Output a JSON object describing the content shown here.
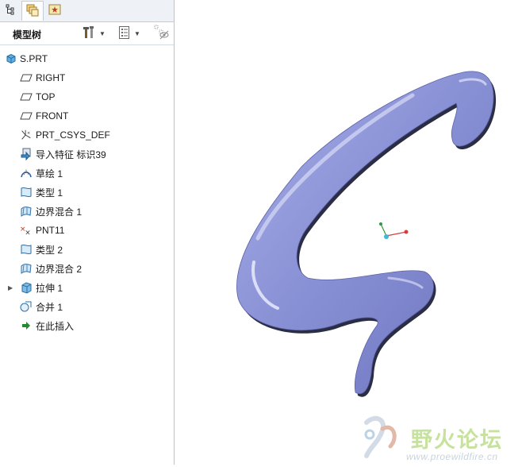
{
  "tabs": [
    {
      "name": "model-tree-tab",
      "icon": "tree-structure-icon"
    },
    {
      "name": "folder-browser-tab",
      "icon": "folders-icon"
    },
    {
      "name": "favorites-tab",
      "icon": "star-icon"
    }
  ],
  "header": {
    "title": "模型树",
    "settings_icon": "tools-icon",
    "show_icon": "list-icon",
    "filter_icon": "filter-icon"
  },
  "tree": {
    "root": "S.PRT",
    "items": [
      {
        "label": "RIGHT",
        "icon": "datum-plane-icon"
      },
      {
        "label": "TOP",
        "icon": "datum-plane-icon"
      },
      {
        "label": "FRONT",
        "icon": "datum-plane-icon"
      },
      {
        "label": "PRT_CSYS_DEF",
        "icon": "csys-icon"
      },
      {
        "label": "导入特征 标识39",
        "icon": "import-feature-icon"
      },
      {
        "label": "草绘 1",
        "icon": "sketch-icon"
      },
      {
        "label": "类型 1",
        "icon": "style-surface-icon"
      },
      {
        "label": "边界混合 1",
        "icon": "boundary-blend-icon"
      },
      {
        "label": "PNT11",
        "icon": "datum-point-icon"
      },
      {
        "label": "类型 2",
        "icon": "style-surface-icon"
      },
      {
        "label": "边界混合 2",
        "icon": "boundary-blend-icon"
      },
      {
        "label": "拉伸 1",
        "icon": "extrude-icon",
        "expandable": true
      },
      {
        "label": "合并 1",
        "icon": "merge-icon"
      },
      {
        "label": "在此插入",
        "icon": "insert-here-icon"
      }
    ]
  },
  "watermark": {
    "text": "野火论坛",
    "url": "www.proewildfire.cn"
  },
  "colors": {
    "model_fill": "#8a92d6",
    "model_shadow": "#2b2d45",
    "watermark_green": "#c7e29d"
  }
}
